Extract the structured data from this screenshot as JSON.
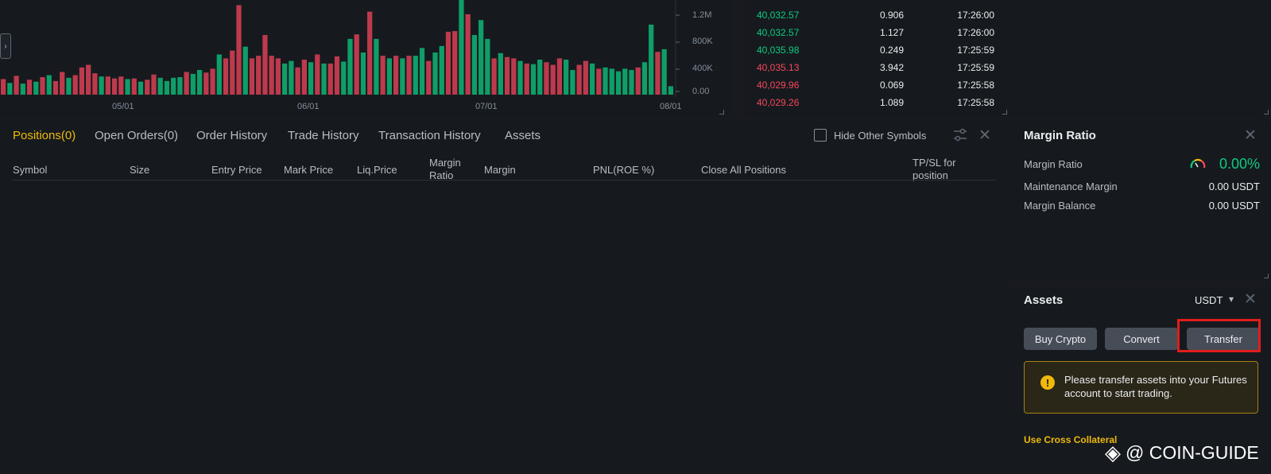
{
  "chart": {
    "y_ticks": [
      "1.2M",
      "800K",
      "400K",
      "0.00"
    ],
    "x_ticks": [
      "05/01",
      "06/01",
      "07/01",
      "08/01"
    ],
    "toggle_glyph": "›",
    "colors": {
      "up": "#0ecb81",
      "down": "#f6465d"
    },
    "volume_bars": [
      {
        "v": 240000,
        "c": "down"
      },
      {
        "v": 180000,
        "c": "up"
      },
      {
        "v": 290000,
        "c": "down"
      },
      {
        "v": 170000,
        "c": "up"
      },
      {
        "v": 230000,
        "c": "down"
      },
      {
        "v": 200000,
        "c": "up"
      },
      {
        "v": 270000,
        "c": "down"
      },
      {
        "v": 300000,
        "c": "up"
      },
      {
        "v": 210000,
        "c": "down"
      },
      {
        "v": 350000,
        "c": "down"
      },
      {
        "v": 260000,
        "c": "up"
      },
      {
        "v": 300000,
        "c": "down"
      },
      {
        "v": 420000,
        "c": "down"
      },
      {
        "v": 460000,
        "c": "down"
      },
      {
        "v": 330000,
        "c": "down"
      },
      {
        "v": 280000,
        "c": "up"
      },
      {
        "v": 280000,
        "c": "down"
      },
      {
        "v": 250000,
        "c": "down"
      },
      {
        "v": 280000,
        "c": "down"
      },
      {
        "v": 240000,
        "c": "up"
      },
      {
        "v": 250000,
        "c": "down"
      },
      {
        "v": 200000,
        "c": "up"
      },
      {
        "v": 230000,
        "c": "down"
      },
      {
        "v": 310000,
        "c": "down"
      },
      {
        "v": 260000,
        "c": "up"
      },
      {
        "v": 210000,
        "c": "up"
      },
      {
        "v": 260000,
        "c": "up"
      },
      {
        "v": 270000,
        "c": "up"
      },
      {
        "v": 350000,
        "c": "down"
      },
      {
        "v": 320000,
        "c": "up"
      },
      {
        "v": 380000,
        "c": "up"
      },
      {
        "v": 340000,
        "c": "down"
      },
      {
        "v": 400000,
        "c": "down"
      },
      {
        "v": 620000,
        "c": "up"
      },
      {
        "v": 560000,
        "c": "down"
      },
      {
        "v": 680000,
        "c": "down"
      },
      {
        "v": 1380000,
        "c": "down"
      },
      {
        "v": 740000,
        "c": "up"
      },
      {
        "v": 560000,
        "c": "down"
      },
      {
        "v": 600000,
        "c": "down"
      },
      {
        "v": 920000,
        "c": "down"
      },
      {
        "v": 600000,
        "c": "down"
      },
      {
        "v": 560000,
        "c": "down"
      },
      {
        "v": 480000,
        "c": "up"
      },
      {
        "v": 520000,
        "c": "up"
      },
      {
        "v": 420000,
        "c": "down"
      },
      {
        "v": 540000,
        "c": "down"
      },
      {
        "v": 500000,
        "c": "up"
      },
      {
        "v": 620000,
        "c": "down"
      },
      {
        "v": 480000,
        "c": "up"
      },
      {
        "v": 480000,
        "c": "down"
      },
      {
        "v": 590000,
        "c": "down"
      },
      {
        "v": 510000,
        "c": "up"
      },
      {
        "v": 860000,
        "c": "up"
      },
      {
        "v": 930000,
        "c": "down"
      },
      {
        "v": 650000,
        "c": "up"
      },
      {
        "v": 1280000,
        "c": "down"
      },
      {
        "v": 860000,
        "c": "up"
      },
      {
        "v": 600000,
        "c": "down"
      },
      {
        "v": 560000,
        "c": "up"
      },
      {
        "v": 600000,
        "c": "down"
      },
      {
        "v": 560000,
        "c": "up"
      },
      {
        "v": 600000,
        "c": "down"
      },
      {
        "v": 600000,
        "c": "up"
      },
      {
        "v": 720000,
        "c": "up"
      },
      {
        "v": 520000,
        "c": "down"
      },
      {
        "v": 650000,
        "c": "up"
      },
      {
        "v": 750000,
        "c": "up"
      },
      {
        "v": 970000,
        "c": "down"
      },
      {
        "v": 980000,
        "c": "down"
      },
      {
        "v": 1460000,
        "c": "up"
      },
      {
        "v": 1240000,
        "c": "down"
      },
      {
        "v": 920000,
        "c": "up"
      },
      {
        "v": 1150000,
        "c": "up"
      },
      {
        "v": 860000,
        "c": "up"
      },
      {
        "v": 560000,
        "c": "down"
      },
      {
        "v": 640000,
        "c": "up"
      },
      {
        "v": 580000,
        "c": "down"
      },
      {
        "v": 560000,
        "c": "down"
      },
      {
        "v": 520000,
        "c": "up"
      },
      {
        "v": 480000,
        "c": "down"
      },
      {
        "v": 470000,
        "c": "up"
      },
      {
        "v": 540000,
        "c": "up"
      },
      {
        "v": 500000,
        "c": "down"
      },
      {
        "v": 460000,
        "c": "down"
      },
      {
        "v": 560000,
        "c": "down"
      },
      {
        "v": 540000,
        "c": "up"
      },
      {
        "v": 380000,
        "c": "up"
      },
      {
        "v": 460000,
        "c": "down"
      },
      {
        "v": 520000,
        "c": "down"
      },
      {
        "v": 480000,
        "c": "up"
      },
      {
        "v": 400000,
        "c": "down"
      },
      {
        "v": 420000,
        "c": "up"
      },
      {
        "v": 400000,
        "c": "up"
      },
      {
        "v": 360000,
        "c": "up"
      },
      {
        "v": 400000,
        "c": "up"
      },
      {
        "v": 380000,
        "c": "up"
      },
      {
        "v": 420000,
        "c": "down"
      },
      {
        "v": 500000,
        "c": "up"
      },
      {
        "v": 1080000,
        "c": "up"
      },
      {
        "v": 660000,
        "c": "down"
      },
      {
        "v": 700000,
        "c": "up"
      },
      {
        "v": 130000,
        "c": "up"
      }
    ]
  },
  "trades": [
    {
      "price": "40,032.57",
      "side": "buy",
      "amount": "0.906",
      "time": "17:26:00"
    },
    {
      "price": "40,032.57",
      "side": "buy",
      "amount": "1.127",
      "time": "17:26:00"
    },
    {
      "price": "40,035.98",
      "side": "buy",
      "amount": "0.249",
      "time": "17:25:59"
    },
    {
      "price": "40,035.13",
      "side": "sell",
      "amount": "3.942",
      "time": "17:25:59"
    },
    {
      "price": "40,029.96",
      "side": "sell",
      "amount": "0.069",
      "time": "17:25:58"
    },
    {
      "price": "40,029.26",
      "side": "sell",
      "amount": "1.089",
      "time": "17:25:58"
    }
  ],
  "positions": {
    "tabs": [
      "Positions(0)",
      "Open Orders(0)",
      "Order History",
      "Trade History",
      "Transaction History",
      "Assets"
    ],
    "active_tab": 0,
    "hide_other_label": "Hide Other Symbols",
    "hide_other_checked": false,
    "columns": [
      "Symbol",
      "Size",
      "Entry Price",
      "Mark Price",
      "Liq.Price",
      "Margin Ratio",
      "Margin",
      "PNL(ROE %)",
      "Close All Positions",
      "TP/SL for position"
    ]
  },
  "margin": {
    "title": "Margin Ratio",
    "ratio_label": "Margin Ratio",
    "ratio_value": "0.00%",
    "maintenance_label": "Maintenance Margin",
    "maintenance_value": "0.00 USDT",
    "balance_label": "Margin Balance",
    "balance_value": "0.00 USDT",
    "ratio_color": "#0ecb81"
  },
  "assets": {
    "title": "Assets",
    "currency": "USDT",
    "buy_label": "Buy Crypto",
    "convert_label": "Convert",
    "transfer_label": "Transfer",
    "alert_text": "Please transfer assets into your Futures account to start trading.",
    "cross_collateral_label": "Use Cross Collateral"
  },
  "watermark": {
    "text": "@ COIN-GUIDE"
  },
  "icons": {
    "close": "✕",
    "caret": "▾",
    "alert": "!",
    "diamond": "◈"
  }
}
